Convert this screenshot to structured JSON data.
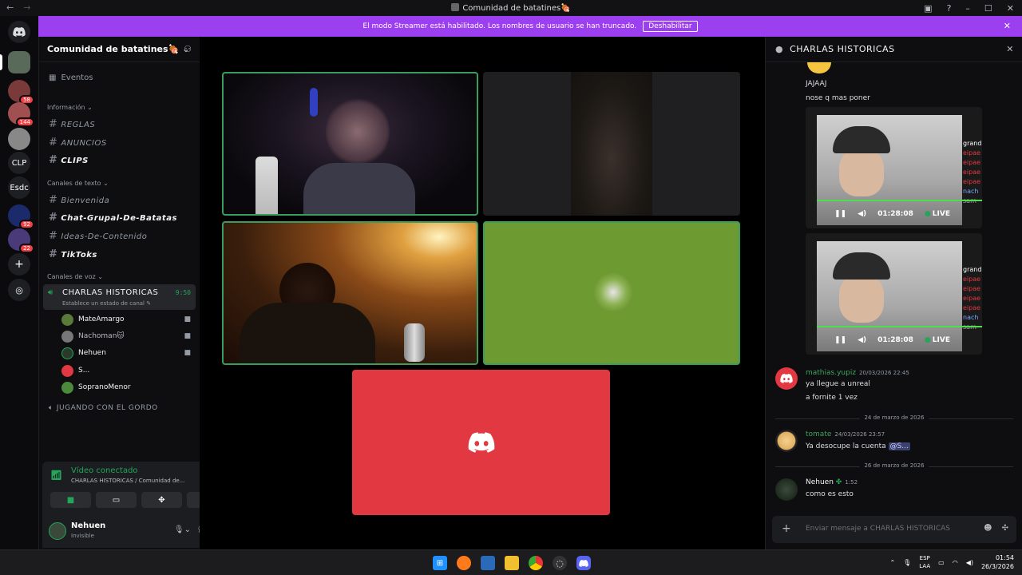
{
  "window": {
    "title": "Comunidad de batatines🍖",
    "back": "←",
    "forward": "→"
  },
  "banner": {
    "text": "El modo Streamer está habilitado. Los nombres de usuario se han truncado.",
    "button": "Deshabilitar"
  },
  "rail": {
    "servers": [
      {
        "label": "",
        "badge": ""
      },
      {
        "label": "",
        "badge": "58"
      },
      {
        "label": "",
        "badge": "144"
      },
      {
        "label": "",
        "badge": ""
      },
      {
        "label": "CLP",
        "badge": ""
      },
      {
        "label": "Esdc",
        "badge": ""
      },
      {
        "label": "",
        "badge": "92"
      },
      {
        "label": "",
        "badge": "22"
      }
    ]
  },
  "sidebar": {
    "server_name": "Comunidad de batatines🍖",
    "events": "Eventos",
    "categories": {
      "info": "Información",
      "text": "Canales de texto",
      "voice": "Canales de voz"
    },
    "info_channels": [
      "REGLAS",
      "ANUNCIOS",
      "CLIPS"
    ],
    "text_channels": [
      "Bienvenida",
      "Chat-Grupal-De-Batatas",
      "Ideas-De-Contenido",
      "TikToks"
    ],
    "voice_channel": {
      "name": "CHARLAS HISTORICAS",
      "status": "Establece un estado de canal",
      "time": "9:50"
    },
    "voice_users": [
      "MateAmargo",
      "Nachoman😽",
      "Nehuen",
      "S...",
      "SopranoMenor"
    ],
    "voice_channel_2": "JUGANDO CON EL GORDO"
  },
  "rtc": {
    "status": "Vídeo conectado",
    "location": "CHARLAS HISTORICAS / Comunidad de..."
  },
  "user": {
    "name": "Nehuen",
    "status": "Invisible"
  },
  "chat": {
    "title": "CHARLAS HISTORICAS",
    "lines_top": [
      "JAJAAJ",
      "nose q mas poner"
    ],
    "clips": [
      {
        "time": "01:28:08",
        "live": "LIVE",
        "side": [
          "grand",
          "eipae",
          "eipae",
          "eipae",
          "eipae",
          "nach",
          "sam"
        ]
      },
      {
        "time": "01:28:08",
        "live": "LIVE",
        "side": [
          "grand",
          "eipae",
          "eipae",
          "eipae",
          "eipae",
          "nach",
          "sam"
        ]
      }
    ],
    "msg1": {
      "author": "mathias.yupiz",
      "time": "20/03/2026 22:45",
      "lines": [
        "ya llegue a unreal",
        "a fornite 1 vez"
      ]
    },
    "divider1": "24 de marzo de 2026",
    "msg2": {
      "author": "tomate",
      "time": "24/03/2026 23:57",
      "text": "Ya desocupe la cuenta",
      "mention": "@S..."
    },
    "divider2": "26 de marzo de 2026",
    "msg3": {
      "author": "Nehuen",
      "time": "1:52",
      "text": "como es esto"
    },
    "placeholder": "Enviar mensaje a CHARLAS HISTORICAS"
  },
  "taskbar": {
    "lang1": "ESP",
    "lang2": "LAA",
    "time": "01:54",
    "date": "26/3/2026"
  },
  "colors": {
    "blurple": "#5865f2",
    "green": "#23a55a",
    "banner": "#9b3ff0",
    "red_tile": "#e23842"
  }
}
